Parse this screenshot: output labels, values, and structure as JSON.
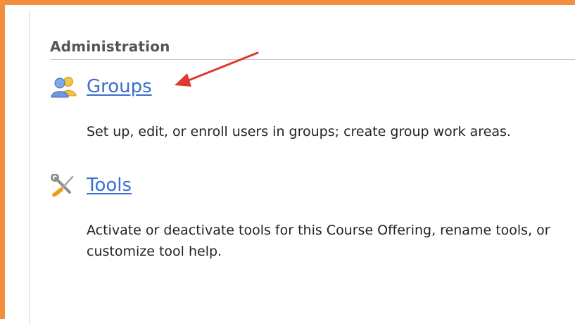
{
  "administration": {
    "title": "Administration",
    "items": [
      {
        "label": "Groups",
        "icon": "groups-icon",
        "description": "Set up, edit, or enroll users in groups; create group work areas."
      },
      {
        "label": "Tools",
        "icon": "tools-icon",
        "description": "Activate or deactivate tools for this Course Offering, rename tools, or customize tool help."
      }
    ]
  },
  "colors": {
    "frame_border": "#F2913D",
    "link": "#3b6fcf",
    "annotation_arrow": "#e0382b"
  }
}
